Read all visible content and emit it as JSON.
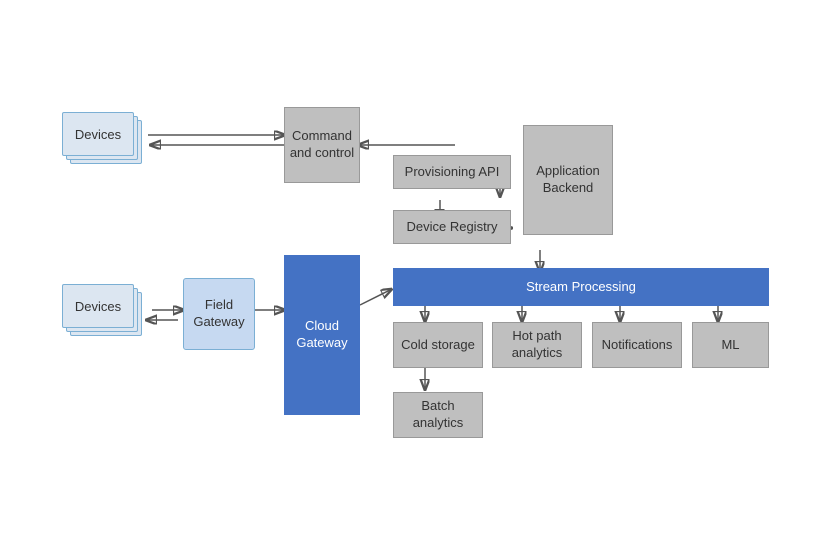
{
  "boxes": {
    "devices_top_label": "Devices",
    "devices_bottom_label": "Devices",
    "field_gateway_label": "Field\nGateway",
    "command_control_label": "Command\nand control",
    "cloud_gateway_label": "Cloud\nGateway",
    "provisioning_api_label": "Provisioning API",
    "device_registry_label": "Device Registry",
    "application_backend_label": "Application\nBackend",
    "stream_processing_label": "Stream Processing",
    "cold_storage_label": "Cold storage",
    "hot_path_analytics_label": "Hot path\nanalytics",
    "notifications_label": "Notifications",
    "ml_label": "ML",
    "batch_analytics_label": "Batch\nanalytics"
  }
}
